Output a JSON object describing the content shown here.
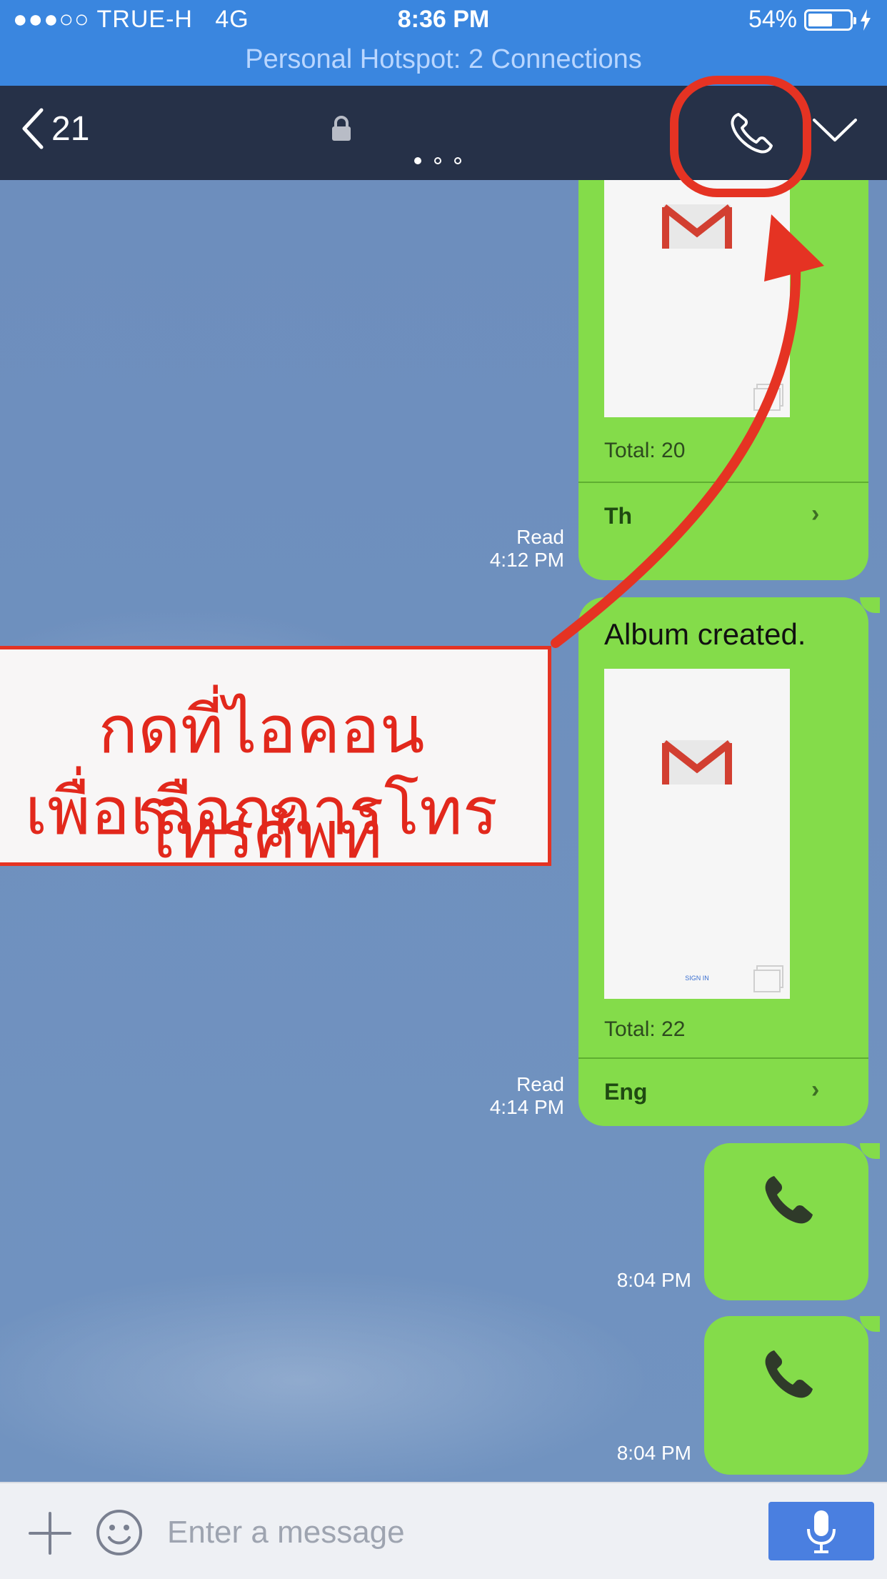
{
  "status_bar": {
    "signal": "●●●○○",
    "carrier": "TRUE-H",
    "network": "4G",
    "time": "8:36 PM",
    "battery": "54%",
    "battery_level": 0.54,
    "hotspot": "Personal Hotspot: 2 Connections"
  },
  "header": {
    "back_count": "21",
    "page_dots": 3,
    "active_dot": 0
  },
  "messages": [
    {
      "type": "album",
      "total": "Total: 20",
      "label": "Th",
      "read": "Read",
      "time": "4:12 PM"
    },
    {
      "type": "album",
      "title": "Album created.",
      "total": "Total: 22",
      "label": "Eng",
      "read": "Read",
      "time": "4:14 PM",
      "thumb_caption": "SIGN IN"
    },
    {
      "type": "call",
      "time": "8:04 PM"
    },
    {
      "type": "call",
      "time": "8:04 PM"
    }
  ],
  "annotation": {
    "line1": "กดที่ไอคอนโทรศัพท์",
    "line2": "เพื่อเลือกการโทร",
    "color": "#e53323"
  },
  "input": {
    "placeholder": "Enter a message"
  },
  "colors": {
    "status_bar": "#3a86df",
    "header": "#263148",
    "bubble": "#84dc4a",
    "mic_button": "#4a7fe0"
  }
}
